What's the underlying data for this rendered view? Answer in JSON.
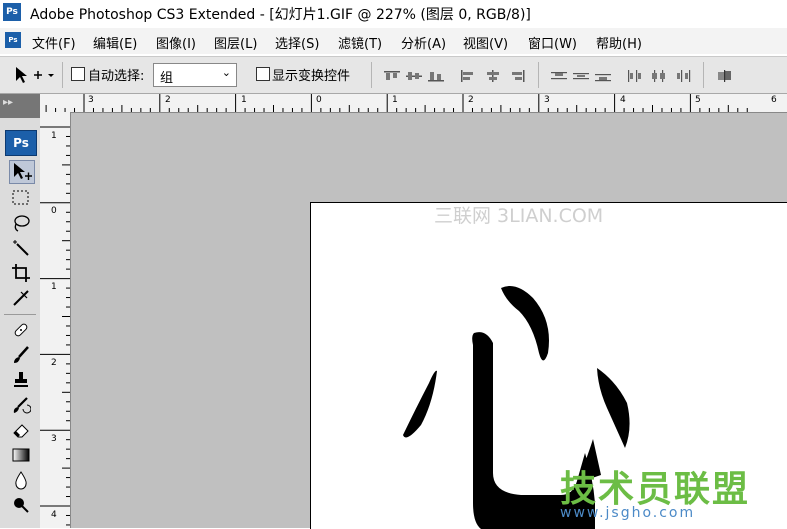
{
  "titlebar": {
    "app_badge": "Ps",
    "title": "Adobe Photoshop CS3 Extended - [幻灯片1.GIF @ 227% (图层 0, RGB/8)]"
  },
  "menubar": {
    "badge": "Ps",
    "items": [
      "文件(F)",
      "编辑(E)",
      "图像(I)",
      "图层(L)",
      "选择(S)",
      "滤镜(T)",
      "分析(A)",
      "视图(V)",
      "窗口(W)",
      "帮助(H)"
    ]
  },
  "options": {
    "auto_select_label": "自动选择:",
    "auto_select_value": "组",
    "show_transform_label": "显示变换控件"
  },
  "toolbox": {
    "collapse_glyph": "▸▸",
    "badge": "Ps"
  },
  "rulers": {
    "top": [
      "3",
      "2",
      "1",
      "0",
      "1",
      "2",
      "3",
      "4",
      "5",
      "6"
    ],
    "left": [
      "1",
      "0",
      "1",
      "2",
      "3",
      "4"
    ]
  },
  "document": {
    "watermark_top": "三联网 3LIAN.COM",
    "watermark_cn": "技术员联盟",
    "watermark_url": "www.jsgho.com"
  },
  "colors": {
    "ps_blue": "#1c5fa9",
    "canvas_gray": "#c0c0c0",
    "watermark_green": "#6cbd45",
    "watermark_blue": "#4c8ac7"
  }
}
